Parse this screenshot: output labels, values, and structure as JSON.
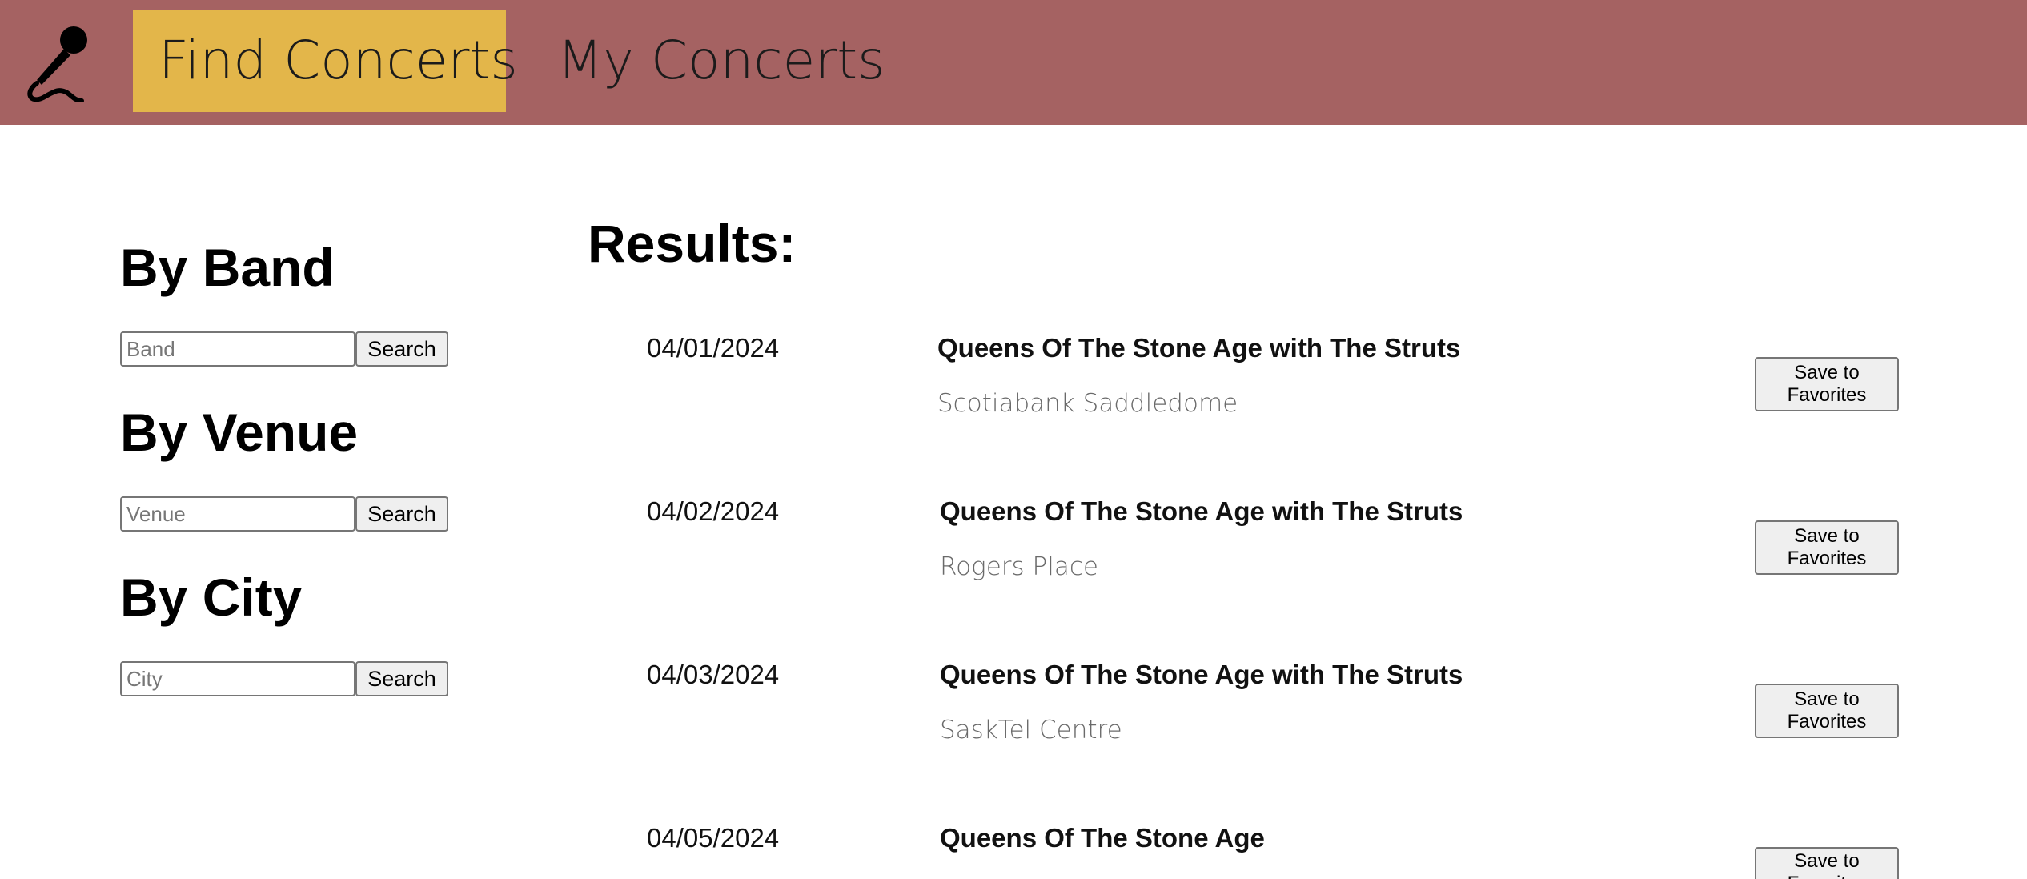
{
  "nav": {
    "logo_icon": "microphone-icon",
    "tabs": [
      {
        "label": "Find Concerts",
        "active": true
      },
      {
        "label": "My Concerts",
        "active": false
      }
    ],
    "colors": {
      "bar": "#a56262",
      "active_tab": "#e3b64a"
    }
  },
  "search": {
    "band": {
      "heading": "By Band",
      "placeholder": "Band",
      "value": "",
      "button": "Search"
    },
    "venue": {
      "heading": "By Venue",
      "placeholder": "Venue",
      "value": "",
      "button": "Search"
    },
    "city": {
      "heading": "By City",
      "placeholder": "City",
      "value": "",
      "button": "Search"
    }
  },
  "results": {
    "heading": "Results:",
    "save_label": "Save to Favorites",
    "items": [
      {
        "date": "04/01/2024",
        "title": "Queens Of The Stone Age with The Struts",
        "venue": "Scotiabank Saddledome"
      },
      {
        "date": "04/02/2024",
        "title": "Queens Of The Stone Age with The Struts",
        "venue": "Rogers Place"
      },
      {
        "date": "04/03/2024",
        "title": "Queens Of The Stone Age with The Struts",
        "venue": "SaskTel Centre"
      },
      {
        "date": "04/05/2024",
        "title": "Queens Of The Stone Age",
        "venue": ""
      }
    ]
  }
}
